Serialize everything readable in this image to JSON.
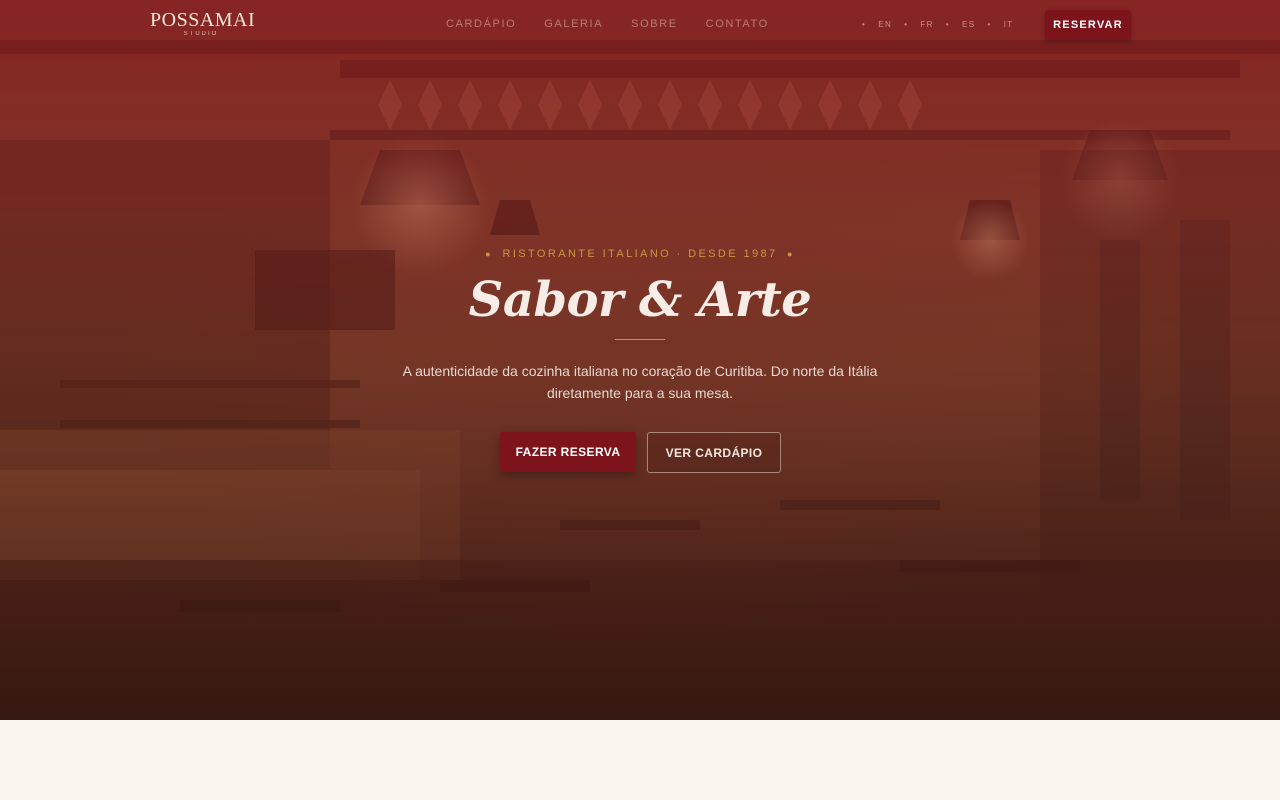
{
  "brand": {
    "name": "POSSAMAI",
    "tagline": "STUDIO"
  },
  "nav": {
    "menu": [
      {
        "label": "CARDÁPIO"
      },
      {
        "label": "GALERIA"
      },
      {
        "label": "SOBRE"
      },
      {
        "label": "CONTATO"
      }
    ],
    "languages": [
      {
        "code": "EN"
      },
      {
        "code": "FR"
      },
      {
        "code": "ES"
      },
      {
        "code": "IT"
      }
    ],
    "reserve_label": "RESERVAR"
  },
  "hero": {
    "eyebrow": "RISTORANTE ITALIANO · DESDE 1987",
    "title": "Sabor & Arte",
    "description": "A autenticidade da cozinha italiana no coração de Curitiba. Do norte da Itália diretamente para a sua mesa.",
    "primary_cta": "FAZER RESERVA",
    "secondary_cta": "VER CARDÁPIO"
  },
  "colors": {
    "accent": "#7d141b",
    "gold": "#c9963f",
    "cream": "#faf5ef"
  }
}
